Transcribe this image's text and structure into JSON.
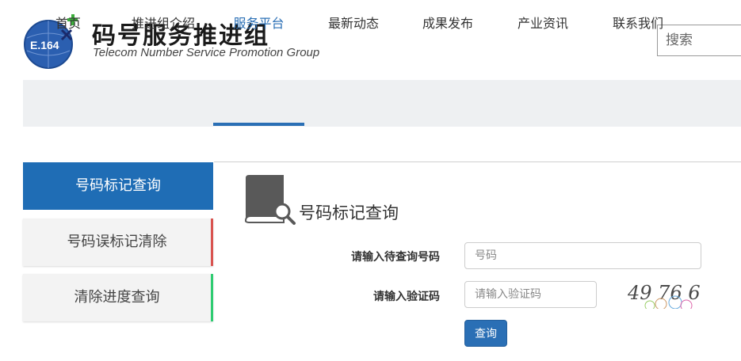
{
  "header": {
    "logo_text": "E.164",
    "title": "码号服务推进组",
    "subtitle": "Telecom Number Service  Promotion Group",
    "search_placeholder": "搜索"
  },
  "nav": {
    "items": [
      {
        "label": "首页"
      },
      {
        "label": "推进组介绍"
      },
      {
        "label": "服务平台",
        "active": true
      },
      {
        "label": "最新动态"
      },
      {
        "label": "成果发布"
      },
      {
        "label": "产业资讯"
      },
      {
        "label": "联系我们"
      }
    ]
  },
  "sidebar": {
    "items": [
      {
        "label": "号码标记查询",
        "active": true
      },
      {
        "label": "号码误标记清除",
        "accent": "#d9534f"
      },
      {
        "label": "清除进度查询",
        "accent": "#2ecc71"
      }
    ]
  },
  "main": {
    "title": "号码标记查询",
    "icon": "phone-book-search-icon",
    "number_label": "请输入待查询号码",
    "number_placeholder": "号码",
    "captcha_label": "请输入验证码",
    "captcha_placeholder": "请输入验证码",
    "captcha_text": "49 76 6",
    "query_button": "查询"
  },
  "colors": {
    "accent": "#2a6fb5",
    "sidebar_active": "#1f6db5",
    "nav_bg": "#eef0f2"
  }
}
